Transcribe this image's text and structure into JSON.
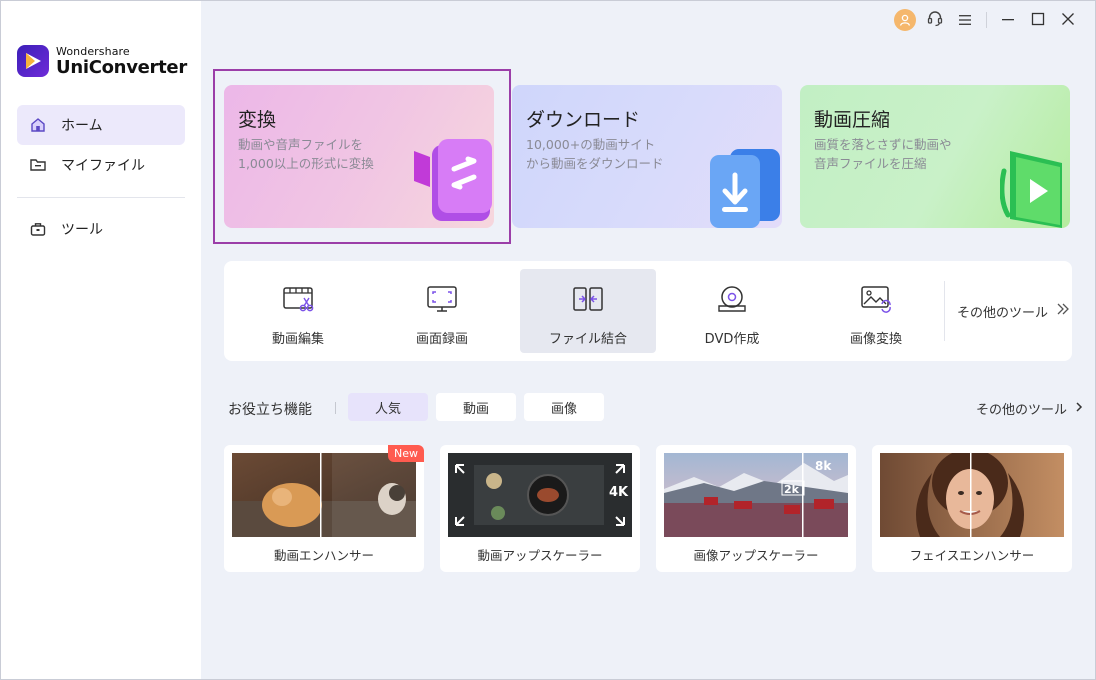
{
  "app": {
    "brand_top": "Wondershare",
    "brand_name": "UniConverter"
  },
  "sidebar": {
    "items": [
      {
        "label": "ホーム",
        "icon": "home-icon",
        "active": true
      },
      {
        "label": "マイファイル",
        "icon": "folder-icon",
        "active": false
      },
      {
        "label": "ツール",
        "icon": "toolbox-icon",
        "active": false
      }
    ]
  },
  "topbar": {
    "icons": [
      "user-avatar-icon",
      "headset-icon",
      "menu-icon",
      "minimize-icon",
      "maximize-icon",
      "close-icon"
    ]
  },
  "cards": [
    {
      "title": "変換",
      "desc": "動画や音声ファイルを1,000以上の形式に変換"
    },
    {
      "title": "ダウンロード",
      "desc": "10,000+の動画サイトから動画をダウンロード"
    },
    {
      "title": "動画圧縮",
      "desc": "画質を落とさずに動画や音声ファイルを圧縮"
    }
  ],
  "tools": {
    "items": [
      {
        "label": "動画編集",
        "icon": "video-edit-icon",
        "active": false
      },
      {
        "label": "画面録画",
        "icon": "screen-record-icon",
        "active": false
      },
      {
        "label": "ファイル結合",
        "icon": "merge-icon",
        "active": true
      },
      {
        "label": "DVD作成",
        "icon": "dvd-icon",
        "active": false
      },
      {
        "label": "画像変換",
        "icon": "image-convert-icon",
        "active": false
      }
    ],
    "more_label": "その他のツール"
  },
  "features_section": {
    "title": "お役立ち機能",
    "tabs": [
      {
        "label": "人気",
        "active": true
      },
      {
        "label": "動画",
        "active": false
      },
      {
        "label": "画像",
        "active": false
      }
    ],
    "more_label": "その他のツール",
    "items": [
      {
        "label": "動画エンハンサー",
        "badge": "New"
      },
      {
        "label": "動画アップスケーラー",
        "overlay": "4K"
      },
      {
        "label": "画像アップスケーラー",
        "overlay_a": "8k",
        "overlay_b": "2k"
      },
      {
        "label": "フェイスエンハンサー"
      }
    ]
  },
  "colors": {
    "accent": "#6c4bd8",
    "selection_border": "#9b3ea8",
    "background": "#eef1f8",
    "new_badge": "#ff5b4f"
  }
}
